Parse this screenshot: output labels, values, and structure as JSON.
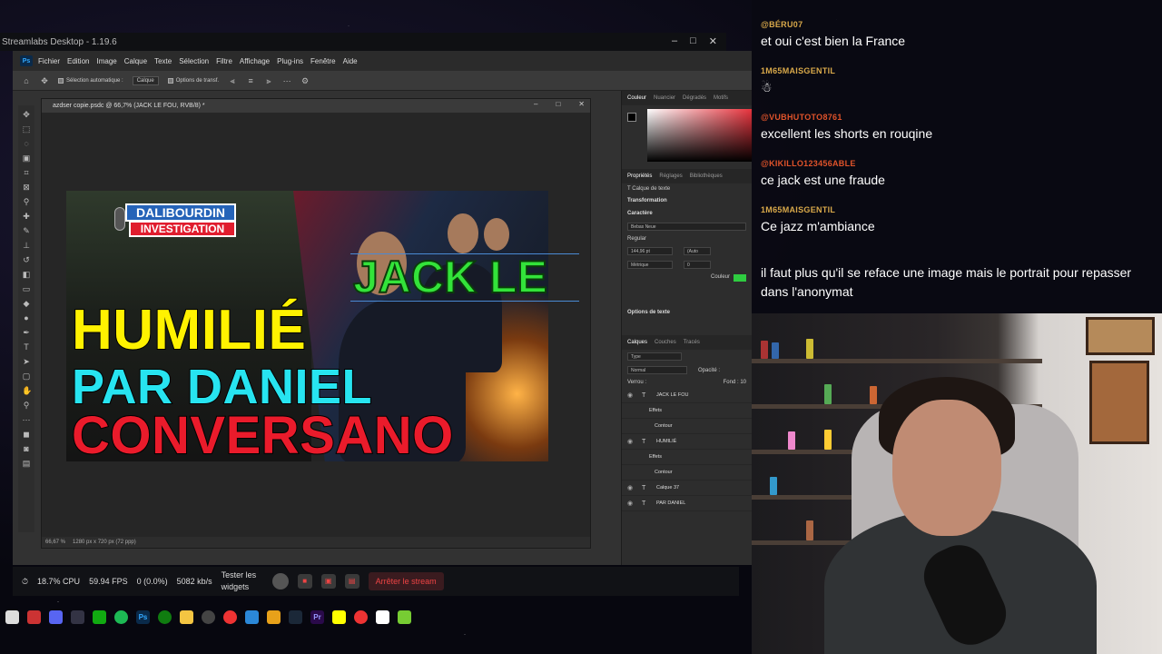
{
  "streamlabs": {
    "title": "Streamlabs Desktop - 1.19.6",
    "controls": [
      "–",
      "□",
      "✕"
    ],
    "stats": {
      "cpu": "18.7% CPU",
      "fps": "59.94 FPS",
      "dropped": "0 (0.0%)",
      "bitrate": "5082 kb/s"
    },
    "test_widgets": "Tester les widgets",
    "stop_stream": "Arrêter le stream"
  },
  "photoshop": {
    "logo": "Ps",
    "menu": [
      "Fichier",
      "Edition",
      "Image",
      "Calque",
      "Texte",
      "Sélection",
      "Filtre",
      "Affichage",
      "Plug-ins",
      "Fenêtre",
      "Aide"
    ],
    "options": {
      "auto_select": "Sélection automatique :",
      "layer_select": "Calque",
      "transform": "Options de transf."
    },
    "doc_tab": "azdser copie.psdc @ 66,7% (JACK LE FOU, RVB/8) *",
    "zoom": "66,67 %",
    "doc_size": "1280 px x 720 px (72 ppp)",
    "panels": {
      "color_tabs": [
        "Couleur",
        "Nuancier",
        "Dégradés",
        "Motifs"
      ],
      "props_tabs": [
        "Propriétés",
        "Réglages",
        "Bibliothèques"
      ],
      "text_layer": "Calque de texte",
      "transformation": "Transformation",
      "caractere": "Caractère",
      "font": "Bebas Neue",
      "style": "Regular",
      "size": "144,96 pt",
      "auto": "(Auto",
      "kerning": "Métrique",
      "tracking": "0",
      "couleur": "Couleur",
      "text_options": "Options de texte",
      "layers_tabs": [
        "Calques",
        "Couches",
        "Tracés"
      ],
      "filter": "Type",
      "blend": "Normal",
      "opacity": "Opacité :",
      "lock": "Verrou :",
      "fill": "Fond : 10",
      "layers": [
        {
          "name": "JACK LE FOU",
          "type": "T"
        },
        {
          "name": "Effets",
          "type": ""
        },
        {
          "name": "Contour",
          "type": ""
        },
        {
          "name": "HUMILIÉ",
          "type": "T"
        },
        {
          "name": "Effets",
          "type": ""
        },
        {
          "name": "Contour",
          "type": ""
        },
        {
          "name": "Calque 37",
          "type": "T"
        },
        {
          "name": "PAR DANIEL",
          "type": "T"
        }
      ]
    }
  },
  "thumbnail": {
    "logo_top": "DALIBOURDIN",
    "logo_bottom": "INVESTIGATION",
    "line1": "HUMILIÉ",
    "line2": "PAR DANIEL",
    "line3": "CONVERSANO",
    "overlay": "JACK LE"
  },
  "chat": [
    {
      "user": "@BÉRU07",
      "text": "et oui c'est bien la France",
      "color": "#d9a94a"
    },
    {
      "user": "1M65MAISGENTIL",
      "text": "",
      "color": "#d9a94a"
    },
    {
      "user": "@VUBHUTOTO8761",
      "text": "excellent les shorts en rouqine",
      "color": "#e0532a"
    },
    {
      "user": "@KIKILLO123456ABLE",
      "text": "ce jack est une fraude",
      "color": "#e0532a"
    },
    {
      "user": "1M65MAISGENTIL",
      "text": "Ce jazz m'ambiance",
      "color": "#d9a94a"
    },
    {
      "user": "",
      "text": "il faut plus qu'il se reface une image mais le portrait pour repasser dans l'anonymat",
      "color": "#c0392b"
    }
  ]
}
